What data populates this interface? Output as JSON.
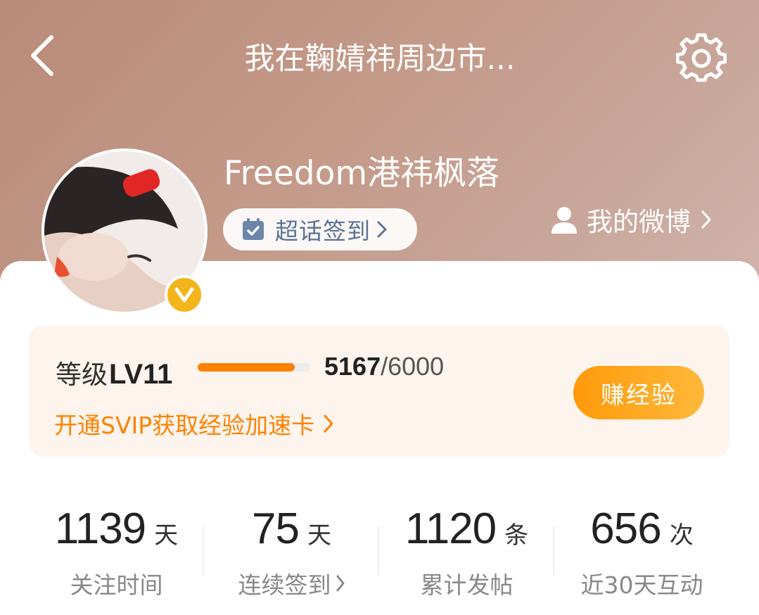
{
  "header": {
    "title": "我在鞠婧祎周边市..."
  },
  "profile": {
    "username": "Freedom港祎枫落",
    "checkin_label": "超话签到",
    "my_weibo_label": "我的微博"
  },
  "level": {
    "label": "等级",
    "level": "LV11",
    "progress_current": "5167",
    "progress_total": "/6000",
    "progress_fraction": 0.861,
    "svip_link": "开通SVIP获取经验加速卡",
    "earn_button": "赚经验"
  },
  "stats": [
    {
      "value": "1139",
      "unit": "天",
      "label": "关注时间"
    },
    {
      "value": "75",
      "unit": "天",
      "label": "连续签到"
    },
    {
      "value": "1120",
      "unit": "条",
      "label": "累计发帖"
    },
    {
      "value": "656",
      "unit": "次",
      "label": "近30天互动"
    }
  ],
  "colors": {
    "accent": "#ff8200",
    "vip_badge": "#f3b51b",
    "checkin_text": "#5a7395"
  },
  "icons": {
    "back": "chevron-left-icon",
    "settings": "gear-icon",
    "checkin": "calendar-check-icon",
    "user": "person-icon",
    "vip": "verified-v-icon"
  }
}
